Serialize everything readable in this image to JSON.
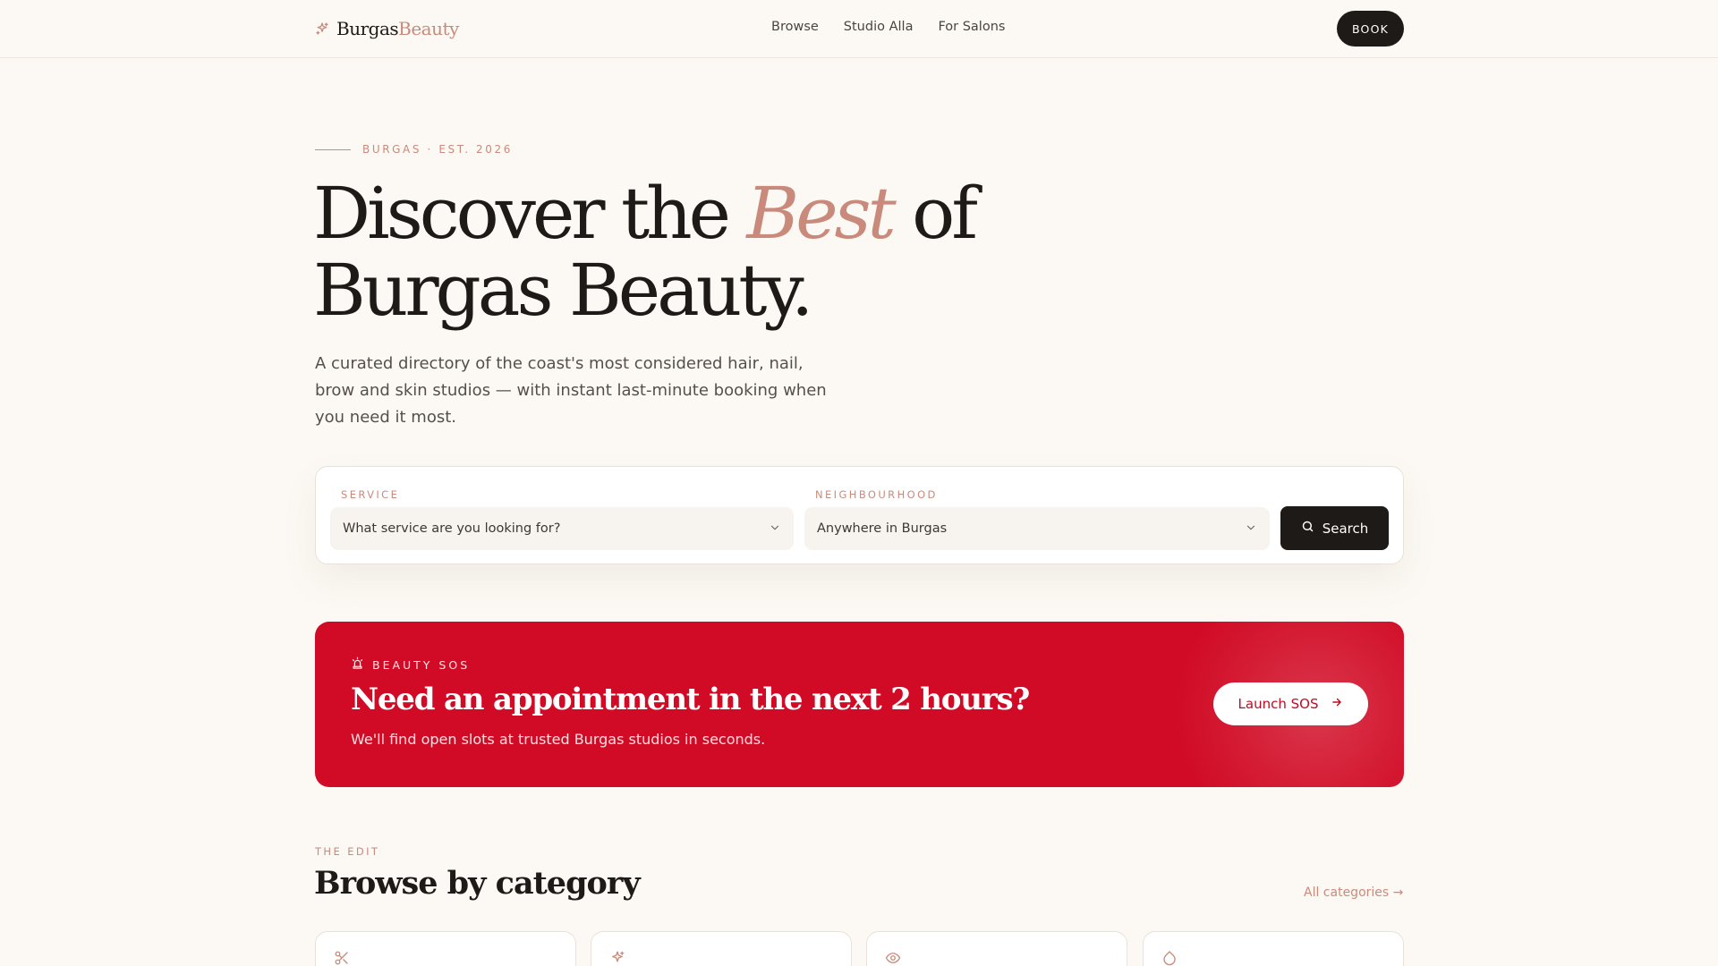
{
  "header": {
    "logo_part1": "Burgas",
    "logo_part2": "Beauty",
    "nav": [
      "Browse",
      "Studio Alla",
      "For Salons"
    ],
    "book_label": "BOOK"
  },
  "hero": {
    "eyebrow": "BURGAS · EST. 2026",
    "title_part1": "Discover the ",
    "title_accent": "Best",
    "title_part2": " of Burgas Beauty.",
    "subtitle": "A curated directory of the coast's most considered hair, nail, brow and skin studios — with instant last-minute booking when you need it most."
  },
  "search": {
    "service_label": "SERVICE",
    "service_value": "What service are you looking for?",
    "neighbourhood_label": "NEIGHBOURHOOD",
    "neighbourhood_value": "Anywhere in Burgas",
    "button_label": "Search"
  },
  "sos": {
    "eyebrow": "BEAUTY SOS",
    "title": "Need an appointment in the next 2 hours?",
    "subtitle": "We'll find open slots at trusted Burgas studios in seconds.",
    "button_label": "Launch SOS"
  },
  "categories": {
    "eyebrow": "THE EDIT",
    "title": "Browse by category",
    "all_link": "All categories →",
    "cards": [
      {
        "icon": "scissors-icon"
      },
      {
        "icon": "sparkles-icon"
      },
      {
        "icon": "eye-icon"
      },
      {
        "icon": "droplet-icon"
      }
    ]
  },
  "colors": {
    "background": "#fcf9f4",
    "accent": "#c98a7c",
    "dark": "#1e1a17",
    "sos_red": "#d10b25"
  }
}
